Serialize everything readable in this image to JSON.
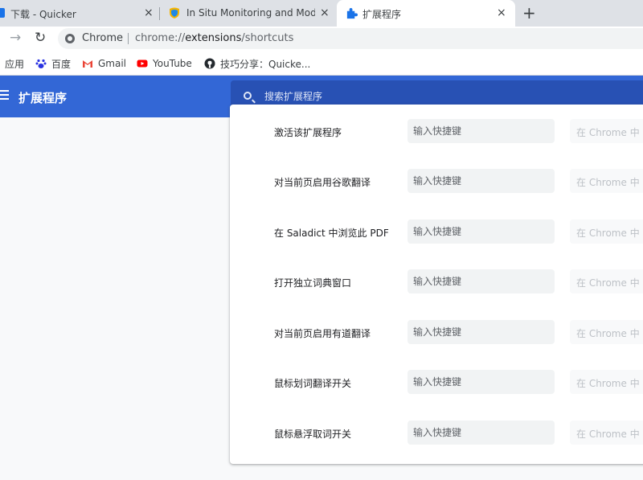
{
  "browser": {
    "tabs": [
      {
        "title": "下载 - Quicker",
        "active": false
      },
      {
        "title": "In Situ Monitoring and Modeling",
        "active": false
      },
      {
        "title": "扩展程序",
        "active": true
      }
    ],
    "close_glyph": "×",
    "new_tab_glyph": "+",
    "omnibox": {
      "chip": "Chrome",
      "url_prefix": "chrome://",
      "url_host": "extensions",
      "url_path": "/shortcuts"
    },
    "bookmarks": [
      {
        "label": "应用",
        "icon": "apps-icon"
      },
      {
        "label": "百度",
        "icon": "baidu-icon"
      },
      {
        "label": "Gmail",
        "icon": "gmail-icon"
      },
      {
        "label": "YouTube",
        "icon": "youtube-icon"
      },
      {
        "label": "技巧分享：Quicke...",
        "icon": "github-icon"
      }
    ]
  },
  "header": {
    "title": "扩展程序",
    "search_placeholder": "搜索扩展程序"
  },
  "shortcuts": {
    "input_placeholder": "输入快捷键",
    "rows": [
      {
        "label": "激活该扩展程序",
        "scope": "在 Chrome 中"
      },
      {
        "label": "对当前页启用谷歌翻译",
        "scope": "在 Chrome 中"
      },
      {
        "label": "在 Saladict 中浏览此 PDF",
        "scope": "在 Chrome 中"
      },
      {
        "label": "打开独立词典窗口",
        "scope": "在 Chrome 中"
      },
      {
        "label": "对当前页启用有道翻译",
        "scope": "在 Chrome 中"
      },
      {
        "label": "鼠标划词翻译开关",
        "scope": "在 Chrome 中"
      },
      {
        "label": "鼠标悬浮取词开关",
        "scope": "在 Chrome 中"
      }
    ]
  },
  "colors": {
    "header_blue": "#3367d6",
    "search_blue": "#2851b4",
    "tab_bg": "#dee1e6"
  }
}
